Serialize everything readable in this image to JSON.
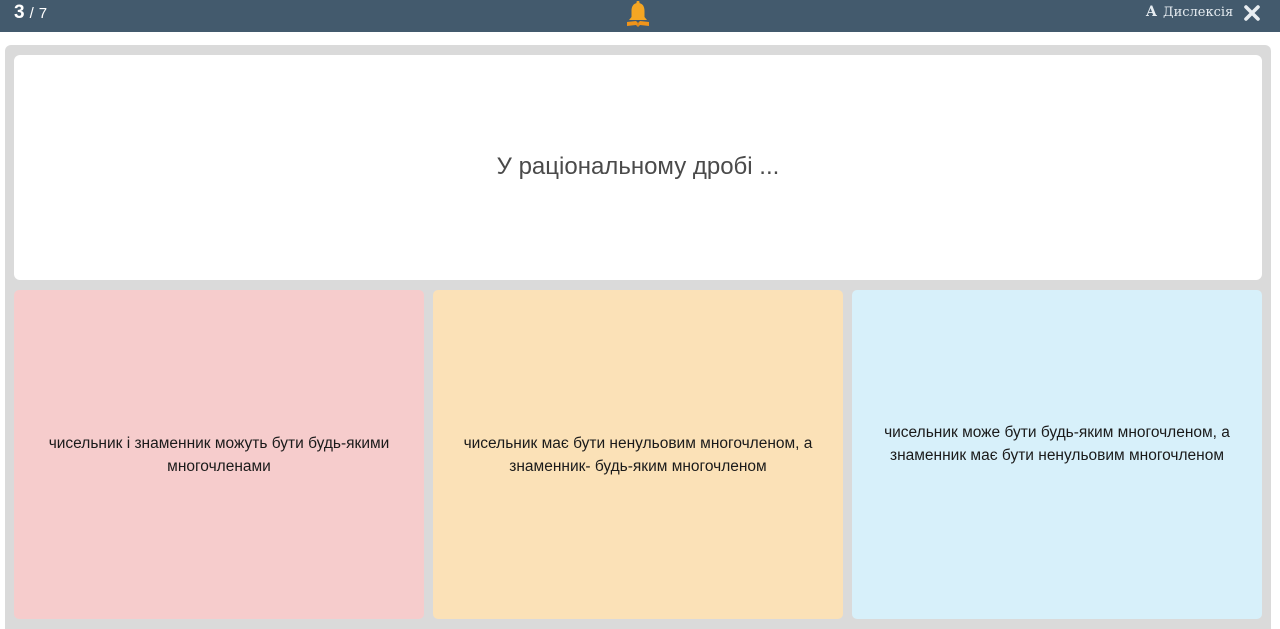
{
  "header": {
    "progress_current": "3",
    "progress_separator": "/",
    "progress_total": "7",
    "bell_icon": "bell-icon",
    "dyslexia_icon_letter": "A",
    "dyslexia_label": "Дислексія",
    "close_icon": "close-icon"
  },
  "question": {
    "text": "У раціональному дробі ..."
  },
  "answers": [
    {
      "text": "чисельник і знаменник можуть бути будь-якими многочленами",
      "color": "#f6cccc"
    },
    {
      "text": "чисельник має бути ненульовим многочленом, а знаменник- будь-яким многочленом",
      "color": "#fbe1b7"
    },
    {
      "text": "чисельник може бути будь-яким многочленом, а знаменник має бути ненульовим многочленом",
      "color": "#d7f0fa"
    }
  ],
  "colors": {
    "topbar": "#435a6d",
    "bell": "#f5a623",
    "stage": "#dadada"
  }
}
